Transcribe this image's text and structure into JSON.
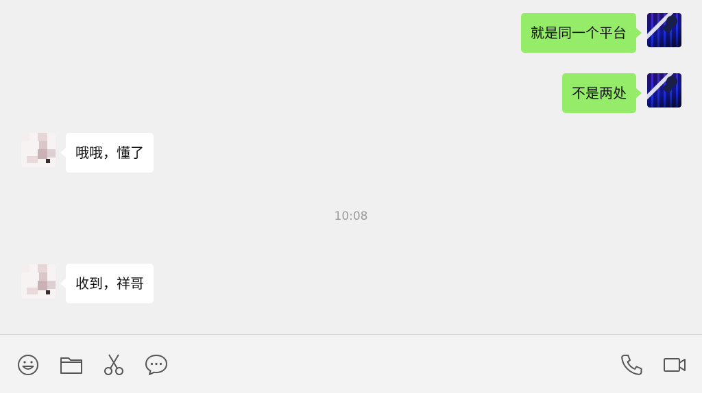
{
  "messages": [
    {
      "side": "self",
      "text": "就是同一个平台",
      "avatar": "self-avatar"
    },
    {
      "side": "self",
      "text": "不是两处",
      "avatar": "self-avatar"
    },
    {
      "side": "other",
      "text": "哦哦，懂了",
      "avatar": "contact-avatar"
    },
    {
      "side": "other",
      "text": "收到，祥哥",
      "avatar": "contact-avatar"
    }
  ],
  "timestamp": "10:08",
  "toolbar": {
    "left_icons": [
      "emoji-icon",
      "folder-icon",
      "scissors-icon",
      "chat-bubble-icon"
    ],
    "right_icons": [
      "phone-icon",
      "video-camera-icon"
    ]
  },
  "colors": {
    "background": "#f0f0f0",
    "self_bubble": "#95ec69",
    "other_bubble": "#ffffff",
    "icon": "#555555"
  }
}
